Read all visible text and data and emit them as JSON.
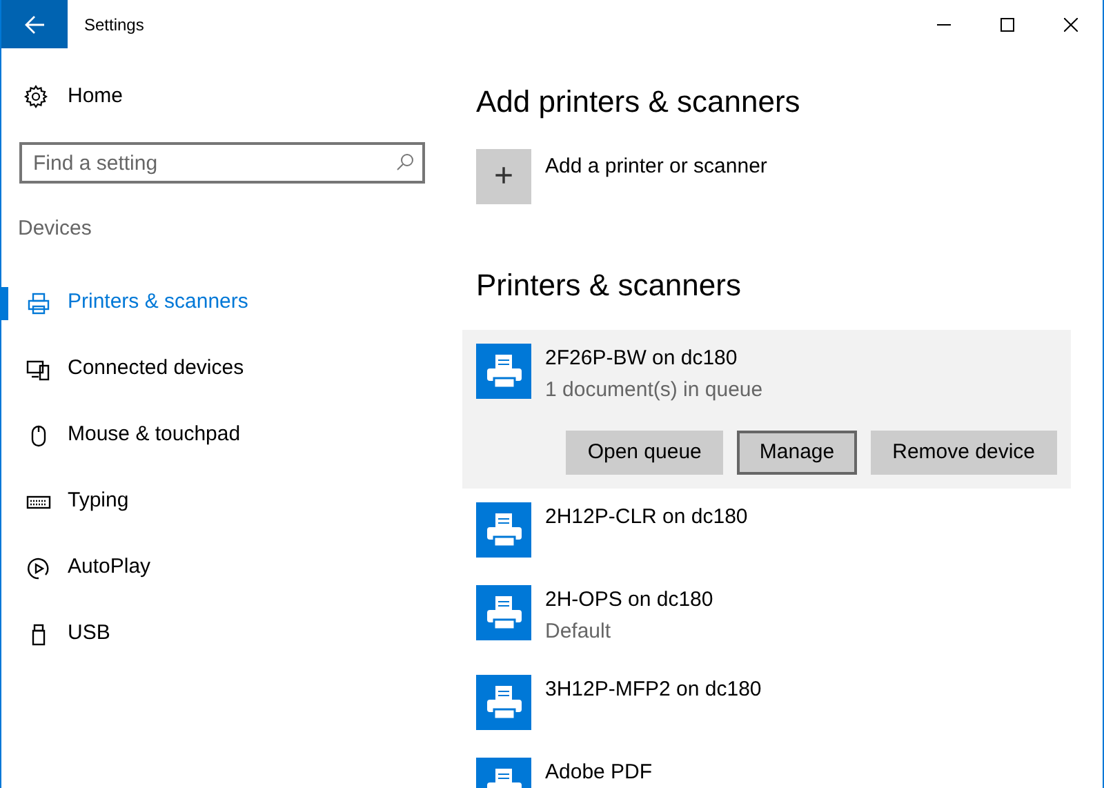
{
  "window": {
    "title": "Settings"
  },
  "sidebar": {
    "home": "Home",
    "search": {
      "placeholder": "Find a setting"
    },
    "section": "Devices",
    "items": [
      {
        "label": "Printers & scanners",
        "kind": "printer",
        "selected": true
      },
      {
        "label": "Connected devices",
        "kind": "devices",
        "selected": false
      },
      {
        "label": "Mouse & touchpad",
        "kind": "mouse",
        "selected": false
      },
      {
        "label": "Typing",
        "kind": "keyboard",
        "selected": false
      },
      {
        "label": "AutoPlay",
        "kind": "autoplay",
        "selected": false
      },
      {
        "label": "USB",
        "kind": "usb",
        "selected": false
      }
    ]
  },
  "main": {
    "add_heading": "Add printers & scanners",
    "add_button": {
      "icon": "+",
      "label": "Add a printer or scanner"
    },
    "list_heading": "Printers & scanners",
    "printers": [
      {
        "name": "2F26P-BW on dc180",
        "status": "1 document(s) in queue",
        "selected": true,
        "buttons": [
          {
            "label": "Open queue",
            "focused": false
          },
          {
            "label": "Manage",
            "focused": true
          },
          {
            "label": "Remove device",
            "focused": false
          }
        ]
      },
      {
        "name": "2H12P-CLR on dc180",
        "selected": false
      },
      {
        "name": "2H-OPS on dc180",
        "status": "Default",
        "selected": false
      },
      {
        "name": "3H12P-MFP2 on dc180",
        "selected": false
      },
      {
        "name": "Adobe PDF",
        "selected": false
      }
    ]
  }
}
